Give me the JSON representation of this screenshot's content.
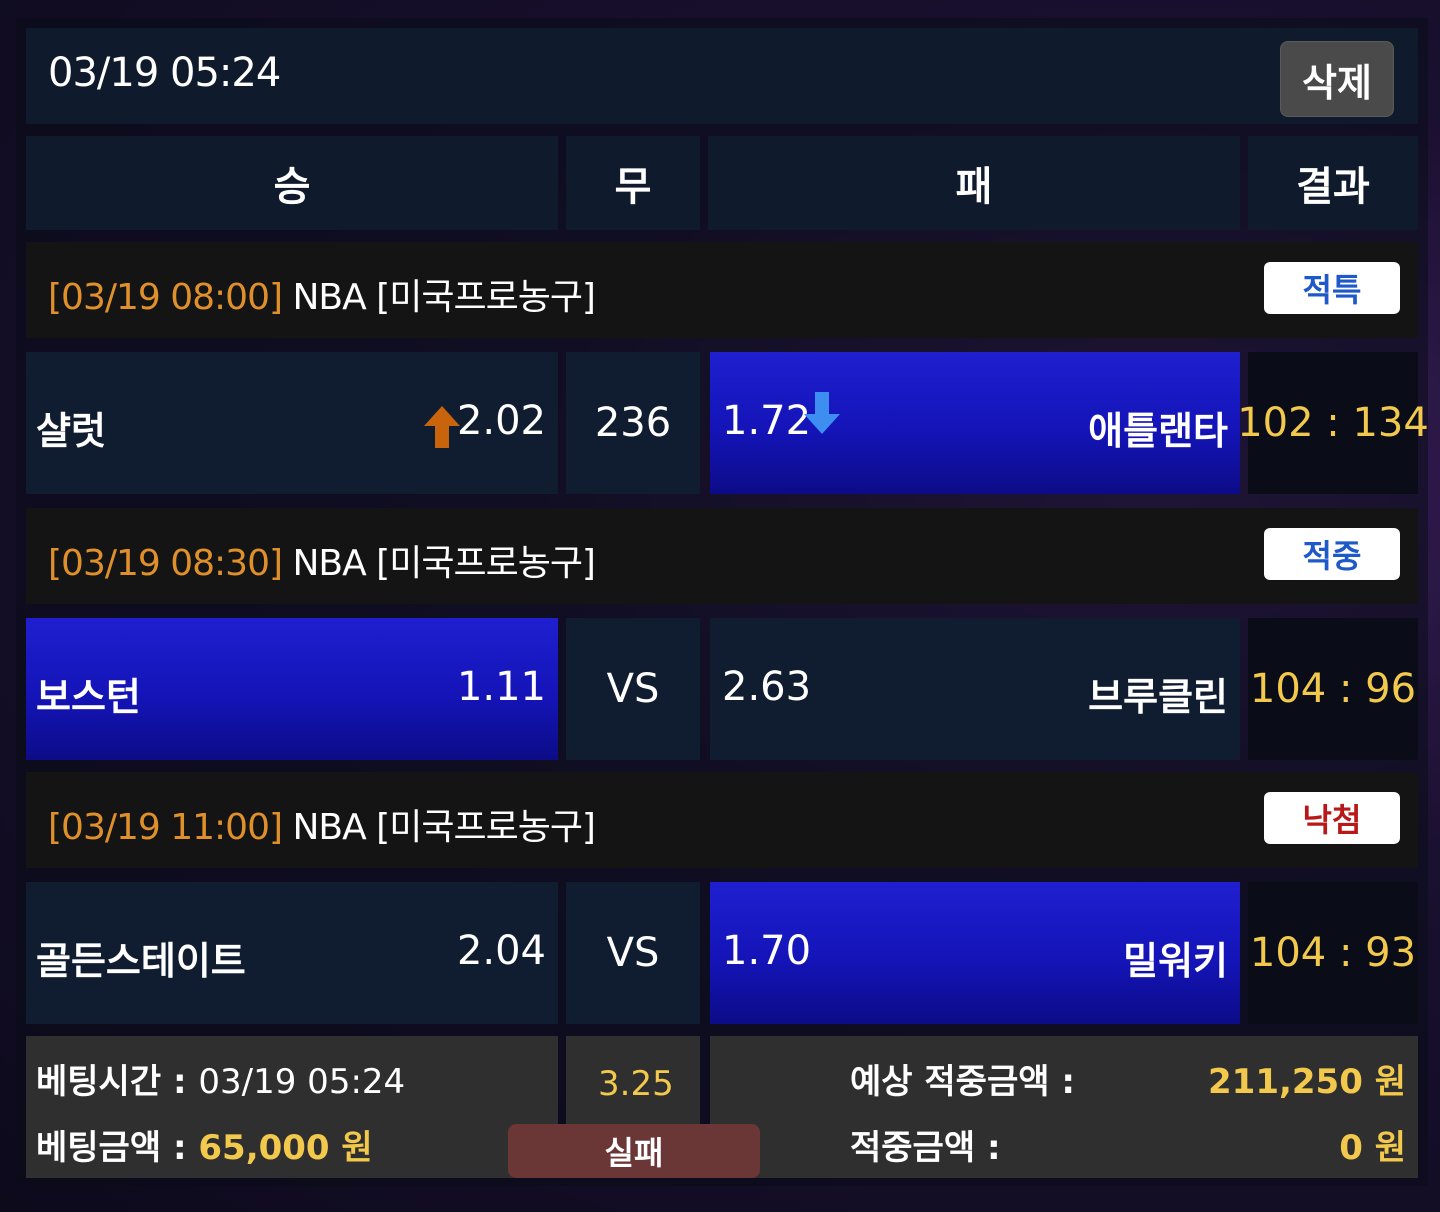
{
  "header": {
    "datetime": "03/19 05:24",
    "delete_label": "삭제"
  },
  "columns": {
    "win": "승",
    "draw": "무",
    "lose": "패",
    "result": "결과"
  },
  "games": [
    {
      "time": "[03/19 08:00]",
      "league": " NBA [미국프로농구]",
      "badge": "적특",
      "home": "샬럿",
      "home_odds": "2.02",
      "middle": "236",
      "away_odds": "1.72",
      "away": "애틀랜타",
      "score_home": "102",
      "score_away": "134",
      "selected": "away",
      "home_trend": "up",
      "away_trend": "down"
    },
    {
      "time": "[03/19 08:30]",
      "league": " NBA [미국프로농구]",
      "badge": "적중",
      "home": "보스턴",
      "home_odds": "1.11",
      "middle": "VS",
      "away_odds": "2.63",
      "away": "브루클린",
      "score_home": "104",
      "score_away": "96",
      "selected": "home"
    },
    {
      "time": "[03/19 11:00]",
      "league": " NBA [미국프로농구]",
      "badge": "낙첨",
      "home": "골든스테이트",
      "home_odds": "2.04",
      "middle": "VS",
      "away_odds": "1.70",
      "away": "밀워키",
      "score_home": "104",
      "score_away": "93",
      "selected": "away"
    }
  ],
  "summary": {
    "bet_time_label": "베팅시간 : ",
    "bet_time": "03/19 05:24",
    "bet_amount_label": "베팅금액 : ",
    "bet_amount": "65,000 원",
    "total_odds": "3.25",
    "status": "실패",
    "expected_label": "예상 적중금액 :",
    "expected_value": "211,250 원",
    "win_label": "적중금액 :",
    "win_value": "0 원"
  },
  "colors": {
    "selected_blue": "#1414b8",
    "time_orange": "#e0902a",
    "score_yellow": "#f2c94c",
    "arrow_up": "#c8650c",
    "arrow_down": "#3d8ef0"
  }
}
